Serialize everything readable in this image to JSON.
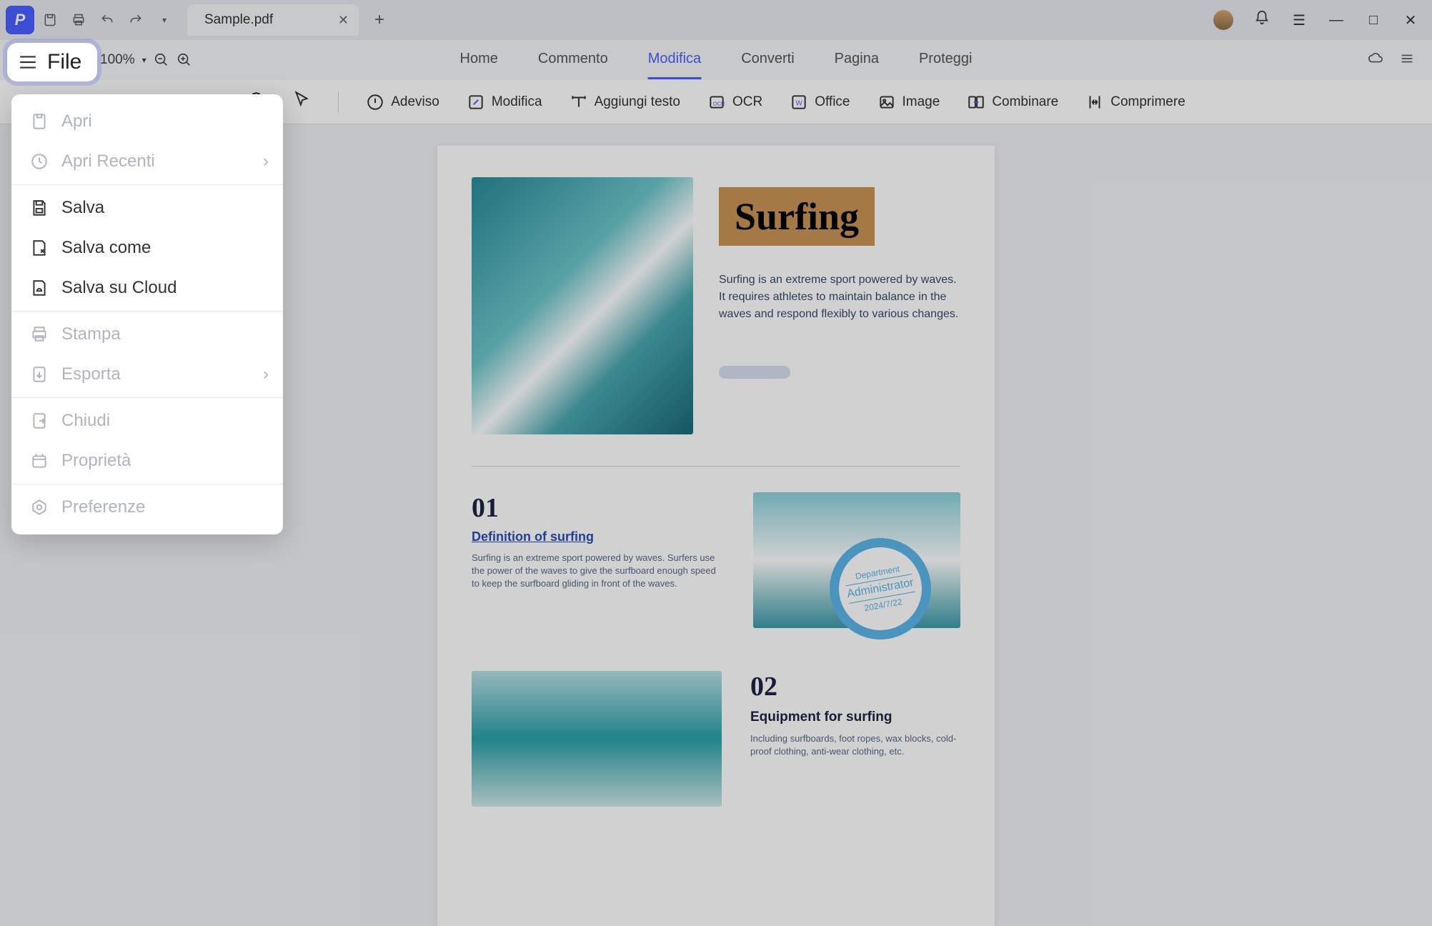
{
  "titlebar": {
    "tab_name": "Sample.pdf"
  },
  "menubar": {
    "zoom": "100%",
    "items": [
      "Home",
      "Commento",
      "Modifica",
      "Converti",
      "Pagina",
      "Proteggi"
    ],
    "active_index": 2
  },
  "toolbar": {
    "items": [
      "Adeviso",
      "Modifica",
      "Aggiungi testo",
      "OCR",
      "Office",
      "Image",
      "Combinare",
      "Comprimere"
    ]
  },
  "file_button": "File",
  "file_menu": {
    "items": [
      {
        "label": "Apri",
        "disabled": true,
        "icon": "file"
      },
      {
        "label": "Apri Recenti",
        "disabled": true,
        "icon": "clock",
        "submenu": true
      },
      {
        "sep": true
      },
      {
        "label": "Salva",
        "disabled": false,
        "icon": "save"
      },
      {
        "label": "Salva come",
        "disabled": false,
        "icon": "saveas"
      },
      {
        "label": "Salva su Cloud",
        "disabled": false,
        "icon": "cloud"
      },
      {
        "sep": true
      },
      {
        "label": "Stampa",
        "disabled": true,
        "icon": "print"
      },
      {
        "label": "Esporta",
        "disabled": true,
        "icon": "export",
        "submenu": true
      },
      {
        "sep": true
      },
      {
        "label": "Chiudi",
        "disabled": true,
        "icon": "close"
      },
      {
        "label": "Proprietà",
        "disabled": true,
        "icon": "props"
      },
      {
        "sep": true
      },
      {
        "label": "Preferenze",
        "disabled": true,
        "icon": "prefs"
      }
    ]
  },
  "document": {
    "title": "Surfing",
    "intro": "Surfing is an extreme sport powered by waves. It requires athletes to maintain balance in the waves and respond flexibly to various changes.",
    "stamp": {
      "top": "Department",
      "mid": "Administrator",
      "bottom": "2024/7/22"
    },
    "sec1": {
      "num": "01",
      "heading": "Definition of surfing",
      "body": "Surfing is an extreme sport powered by waves. Surfers use the power of the waves to give the surfboard enough speed to keep the surfboard gliding in front of the waves."
    },
    "sec2": {
      "num": "02",
      "heading": "Equipment for surfing",
      "body": "Including surfboards, foot ropes, wax blocks, cold-proof clothing, anti-wear clothing, etc."
    }
  }
}
